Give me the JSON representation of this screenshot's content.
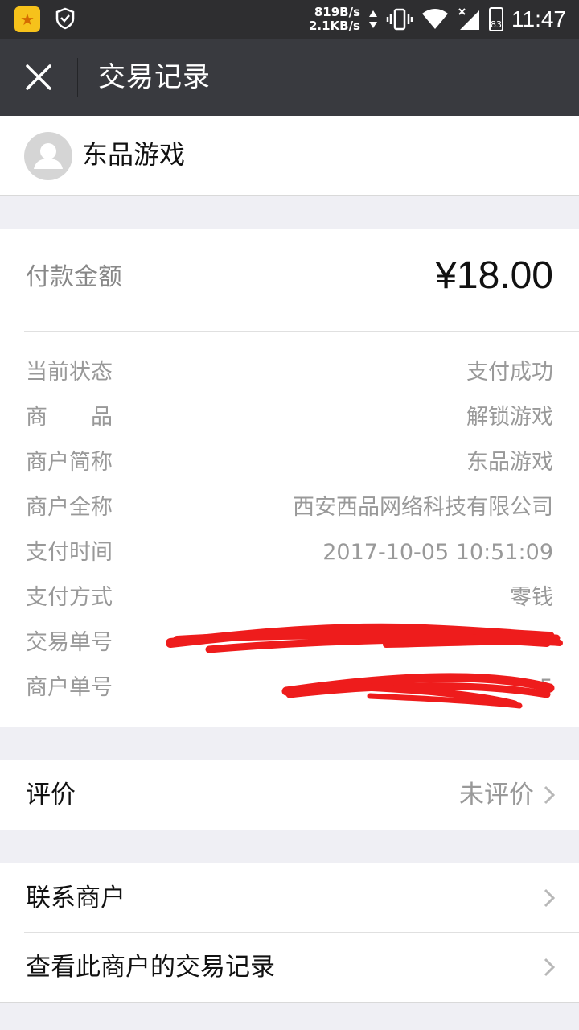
{
  "statusbar": {
    "speed_up": "819B/s",
    "speed_down": "2.1KB/s",
    "battery": "83",
    "time": "11:47"
  },
  "titlebar": {
    "title": "交易记录"
  },
  "merchant": {
    "name": "东品游戏"
  },
  "payment": {
    "amount_label": "付款金额",
    "amount_value": "¥18.00"
  },
  "details": [
    {
      "label": "当前状态",
      "value": "支付成功"
    },
    {
      "label": "商　　品",
      "value": "解锁游戏"
    },
    {
      "label": "商户简称",
      "value": "东品游戏"
    },
    {
      "label": "商户全称",
      "value": "西安西品网络科技有限公司"
    },
    {
      "label": "支付时间",
      "value": "2017-10-05 10:51:09"
    },
    {
      "label": "支付方式",
      "value": "零钱"
    },
    {
      "label": "交易单号",
      "value": ""
    },
    {
      "label": "商户单号",
      "value": "5"
    }
  ],
  "review": {
    "label": "评价",
    "value": "未评价"
  },
  "actions": {
    "contact_label": "联系商户",
    "history_label": "查看此商户的交易记录"
  },
  "colors": {
    "header_bg": "#393a3f",
    "statusbar_bg": "#2e2e30",
    "page_bg": "#efeff4",
    "redaction": "#ee1c1c"
  }
}
